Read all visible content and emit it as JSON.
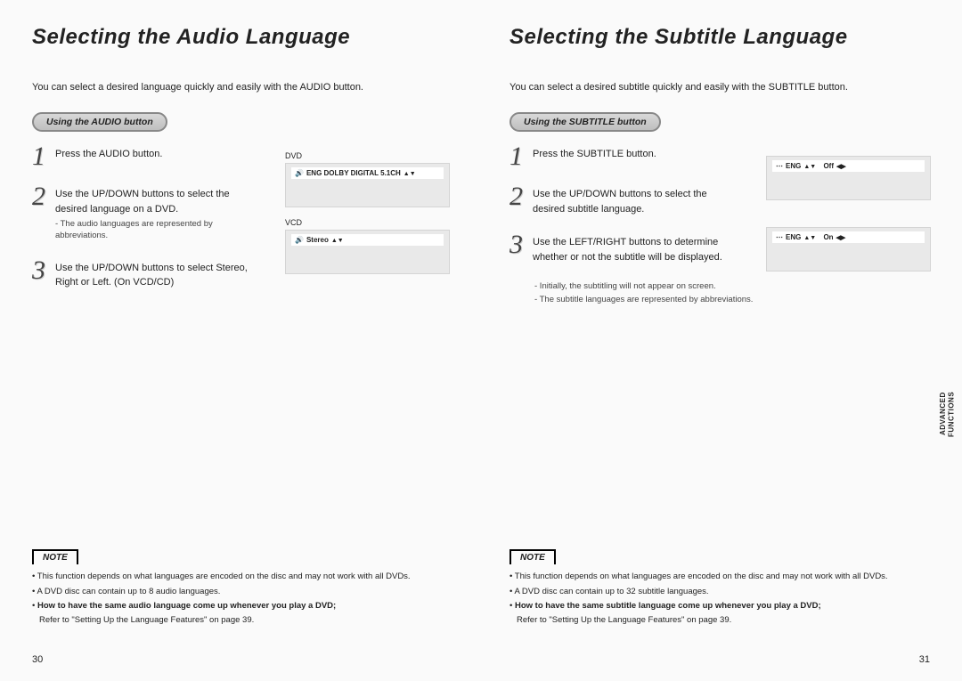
{
  "left": {
    "title": "Selecting the Audio Language",
    "intro": "You can select a desired language quickly and easily with the AUDIO button.",
    "pill": "Using the AUDIO button",
    "steps": [
      {
        "num": "1",
        "text": "Press the AUDIO button."
      },
      {
        "num": "2",
        "text": "Use the UP/DOWN buttons to select the desired language on a DVD.",
        "sub": "- The audio languages are represented by abbreviations."
      },
      {
        "num": "3",
        "text": "Use the UP/DOWN buttons to select Stereo, Right or Left. (On VCD/CD)"
      }
    ],
    "fig": {
      "label1": "DVD",
      "bar1": "ENG DOLBY DIGITAL 5.1CH",
      "label2": "VCD",
      "bar2": "Stereo"
    },
    "note_label": "NOTE",
    "notes": [
      "This function depends on what languages are encoded on the disc and may not work with all DVDs.",
      "A DVD disc can contain up to 8 audio languages."
    ],
    "note_bold": "How to have the same audio language come up whenever you play a DVD;",
    "note_ref": "Refer to \"Setting Up the Language Features\" on page 39.",
    "pagenum": "30"
  },
  "right": {
    "title": "Selecting the Subtitle Language",
    "intro": "You can select a desired subtitle quickly and easily with the SUBTITLE button.",
    "pill": "Using the SUBTITLE button",
    "steps": [
      {
        "num": "1",
        "text": "Press the SUBTITLE button."
      },
      {
        "num": "2",
        "text": "Use the UP/DOWN buttons to select the desired subtitle language."
      },
      {
        "num": "3",
        "text": "Use the LEFT/RIGHT buttons to determine whether or not the subtitle will be displayed."
      }
    ],
    "subnotes": [
      "- Initially, the subtitling will not appear on screen.",
      "- The subtitle languages are represented by abbreviations."
    ],
    "fig": {
      "bar1a": "ENG",
      "bar1b": "Off",
      "bar2a": "ENG",
      "bar2b": "On"
    },
    "note_label": "NOTE",
    "notes": [
      "This function depends on what languages are encoded on the disc and may not work with all DVDs.",
      "A DVD disc can contain up to 32 subtitle languages."
    ],
    "note_bold": "How to have the same subtitle language come up whenever you play a DVD;",
    "note_ref": "Refer to \"Setting Up the Language Features\" on page 39.",
    "pagenum": "31",
    "sidetab": "ADVANCED FUNCTIONS"
  }
}
